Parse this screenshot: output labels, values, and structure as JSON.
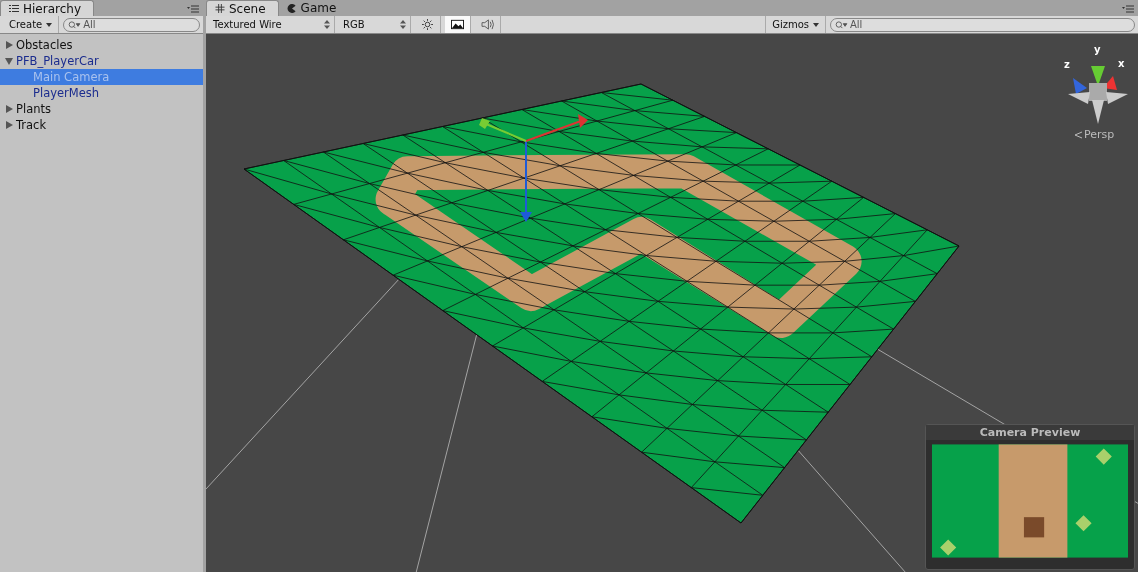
{
  "hierarchy": {
    "title": "Hierarchy",
    "create_button": "Create",
    "search": {
      "placeholder": "All"
    },
    "items": [
      {
        "label": "Obstacles",
        "kind": "group",
        "expanded": false,
        "prefab": false,
        "selected": false
      },
      {
        "label": "PFB_PlayerCar",
        "kind": "group",
        "expanded": true,
        "prefab": true,
        "selected": false,
        "children": [
          {
            "label": "Main Camera",
            "prefab": true,
            "selected": true
          },
          {
            "label": "PlayerMesh",
            "prefab": true,
            "selected": false
          }
        ]
      },
      {
        "label": "Plants",
        "kind": "group",
        "expanded": false,
        "prefab": false,
        "selected": false
      },
      {
        "label": "Track",
        "kind": "group",
        "expanded": false,
        "prefab": false,
        "selected": false
      }
    ]
  },
  "scene": {
    "tabs": [
      {
        "label": "Scene",
        "kind": "scene",
        "selected": true
      },
      {
        "label": "Game",
        "kind": "game",
        "selected": false
      }
    ],
    "draw_mode": "Textured Wire",
    "render_mode": "RGB",
    "toggles": [
      {
        "kind": "lighting",
        "on": false
      },
      {
        "kind": "effects",
        "on": true
      },
      {
        "kind": "audio",
        "on": false
      }
    ],
    "gizmos_button": "Gizmos",
    "search": {
      "placeholder": "All"
    },
    "axis_gizmo": {
      "y": "y",
      "x": "x",
      "z": "z",
      "projection": "Persp"
    },
    "camera_preview": {
      "title": "Camera Preview"
    }
  }
}
